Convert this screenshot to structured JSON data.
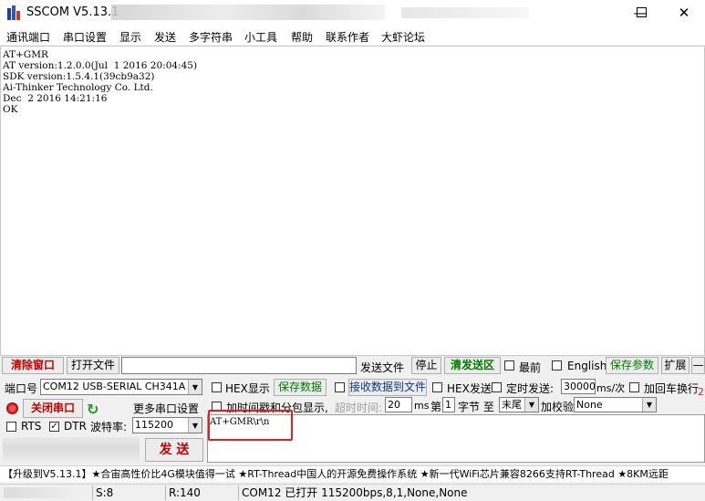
{
  "window": {
    "title": "SSCOM V5.13.1"
  },
  "menu": [
    "通讯端口",
    "串口设置",
    "显示",
    "发送",
    "多字符串",
    "小工具",
    "帮助",
    "联系作者",
    "大虾论坛"
  ],
  "receive": {
    "lines": [
      "AT+GMR",
      "AT version:1.2.0.0(Jul  1 2016 20:04:45)",
      "SDK version:1.5.4.1(39cb9a32)",
      "Ai-Thinker Technology Co. Ltd.",
      "Dec  2 2016 14:21:16",
      "OK"
    ]
  },
  "toolbar1": {
    "clear_window": "清除窗口",
    "open_file": "打开文件",
    "send_file": "发送文件",
    "stop": "停止",
    "clear_send": "清发送区",
    "topmost": "最前",
    "english": "English",
    "save_params": "保存参数",
    "expand": "扩展",
    "collapse": "—"
  },
  "port": {
    "label": "端口号",
    "value": "COM12 USB-SERIAL CH341A",
    "close_port": "关闭串口",
    "more_settings": "更多串口设置",
    "rts": "RTS",
    "dtr": "DTR",
    "baud_label": "波特率:",
    "baud_value": "115200",
    "send": "发 送"
  },
  "options": {
    "hex_display": "HEX显示",
    "save_data": "保存数据",
    "recv_to_file": "接收数据到文件",
    "hex_send": "HEX发送",
    "timed_send": "定时发送:",
    "interval": "30000",
    "interval_unit": "ms/次",
    "add_crlf": "加回车换行",
    "timestamp": "加时间戳和分包显示,",
    "timeout_label": "超时时间:",
    "timeout_value": "20",
    "timeout_unit": "ms",
    "byte_prefix": "第",
    "byte_index": "1",
    "byte_mid": "字节 至",
    "byte_end": "末尾",
    "checksum_label": "加校验",
    "checksum_value": "None",
    "red_num": "2"
  },
  "send_text": "AT+GMR\\r\\n",
  "ticker": "【升级到V5.13.1】★合宙高性价比4G模块值得一试 ★RT-Thread中国人的开源免费操作系统 ★新一代WiFi芯片兼容8266支持RT-Thread ★8KM远距",
  "status": {
    "s": "S:8",
    "r": "R:140",
    "info": "COM12 已打开  115200bps,8,1,None,None"
  },
  "colors": {
    "highlight": "#e02020",
    "accent_red": "#c00000",
    "accent_green": "#007a00"
  }
}
